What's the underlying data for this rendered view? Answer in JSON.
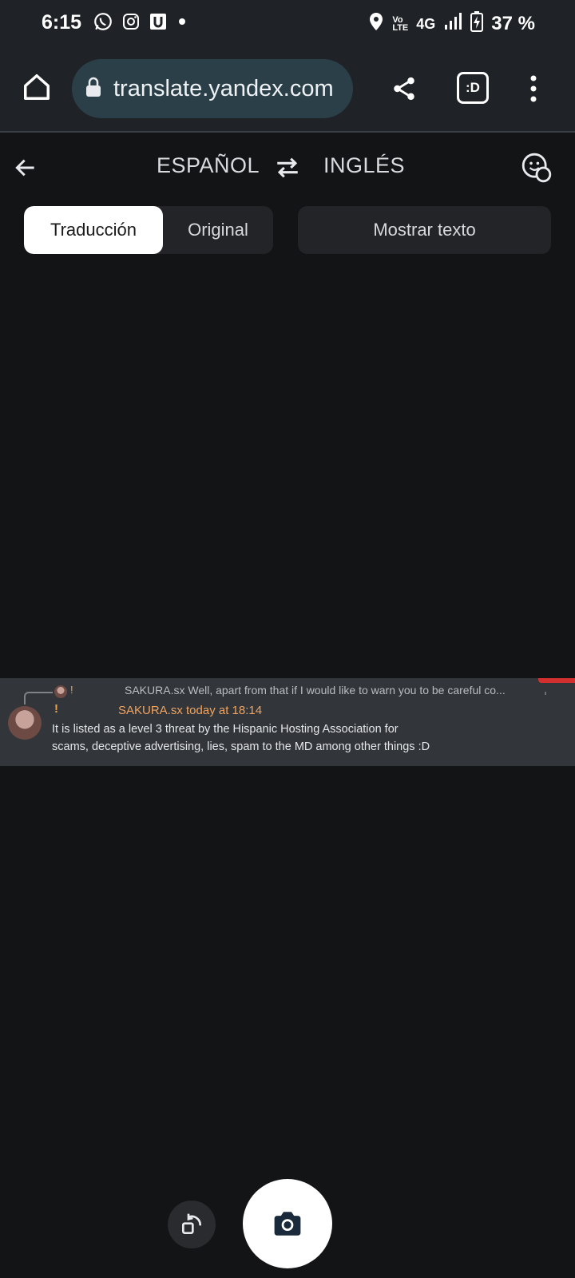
{
  "status_bar": {
    "time": "6:15",
    "notification_icons": [
      "whatsapp-icon",
      "instagram-icon",
      "u-app-icon",
      "dot-icon"
    ],
    "signal_labels": {
      "volte_top": "Vo",
      "volte_bottom": "LTE",
      "network": "4G"
    },
    "battery_percent": "37 %"
  },
  "browser": {
    "url": "translate.yandex.com",
    "tab_badge": ":D"
  },
  "translator": {
    "source_lang": "ESPAÑOL",
    "target_lang": "INGLÉS",
    "tabs": {
      "translation": "Traducción",
      "original": "Original"
    },
    "show_text": "Mostrar texto"
  },
  "translated_image": {
    "reply_preview": "SAKURA.sx Well, apart from that if I would like to warn you to be careful co...",
    "reply_mark": "!",
    "message_mark": "!",
    "author": "SAKURA.sx today at 18:14",
    "lines": [
      "It is listed as a level 3 threat by the Hispanic Hosting Association for",
      "scams, deceptive advertising, lies, spam to the MD among other things :D"
    ]
  },
  "colors": {
    "background": "#131416",
    "toolbar": "#1f2226",
    "url_pill": "#2b3f48",
    "accent_author": "#f0a460",
    "camera_icon": "#1b2a3a"
  }
}
